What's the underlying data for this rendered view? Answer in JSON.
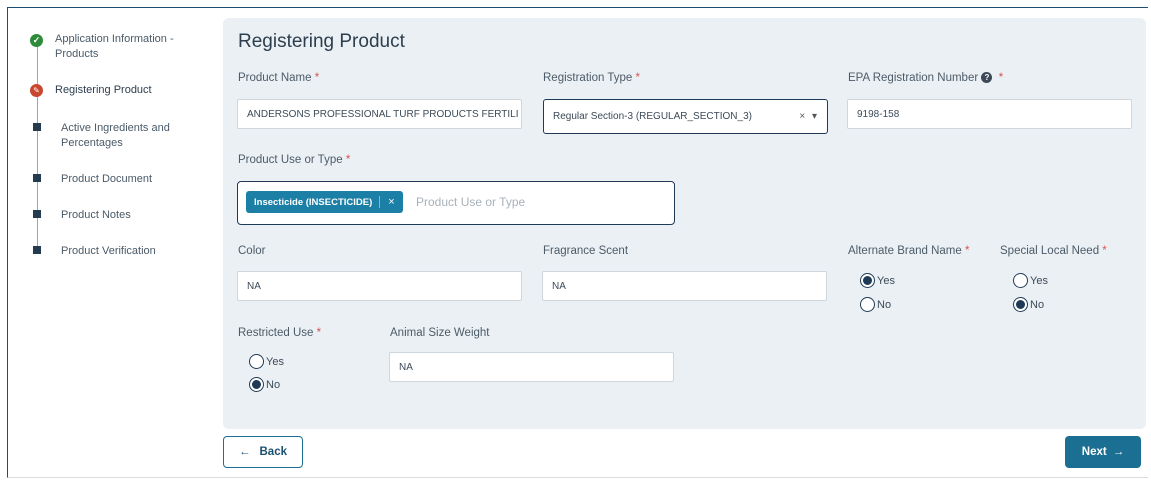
{
  "stepper": {
    "steps": [
      {
        "label": "Application Information - Products",
        "state": "complete"
      },
      {
        "label": "Registering Product",
        "state": "current"
      },
      {
        "label": "Active Ingredients and Percentages",
        "state": "pending"
      },
      {
        "label": "Product Document",
        "state": "pending"
      },
      {
        "label": "Product Notes",
        "state": "pending"
      },
      {
        "label": "Product Verification",
        "state": "pending"
      }
    ],
    "complete_glyph": "✓",
    "current_glyph": "✎"
  },
  "form": {
    "title": "Registering Product",
    "product_name": {
      "label": "Product Name",
      "value": "ANDERSONS PROFESSIONAL TURF PRODUCTS FERTILI"
    },
    "registration_type": {
      "label": "Registration Type",
      "value": "Regular Section-3 (REGULAR_SECTION_3)",
      "clear": "×",
      "caret": "▾"
    },
    "epa_number": {
      "label": "EPA Registration Number",
      "help": "?",
      "value": "9198-158"
    },
    "product_use": {
      "label": "Product Use or Type",
      "chip": "Insecticide (INSECTICIDE)",
      "chip_remove": "×",
      "placeholder": "Product Use or Type"
    },
    "color": {
      "label": "Color",
      "value": "NA"
    },
    "fragrance": {
      "label": "Fragrance Scent",
      "value": "NA"
    },
    "alternate_brand": {
      "label": "Alternate Brand Name",
      "yes": "Yes",
      "no": "No",
      "selected": "Yes"
    },
    "special_local_need": {
      "label": "Special Local Need",
      "yes": "Yes",
      "no": "No",
      "selected": "No"
    },
    "restricted_use": {
      "label": "Restricted Use",
      "yes": "Yes",
      "no": "No",
      "selected": "No"
    },
    "animal_size_weight": {
      "label": "Animal Size Weight",
      "value": "NA"
    },
    "required_marker": "*"
  },
  "footer": {
    "back_label": "Back",
    "back_arrow": "←",
    "next_label": "Next",
    "next_arrow": "→"
  },
  "colors": {
    "primary": "#1a6f93",
    "panel": "#eaf0f4",
    "complete": "#2e8b3a",
    "current": "#c9472e",
    "required": "#d9534f"
  }
}
